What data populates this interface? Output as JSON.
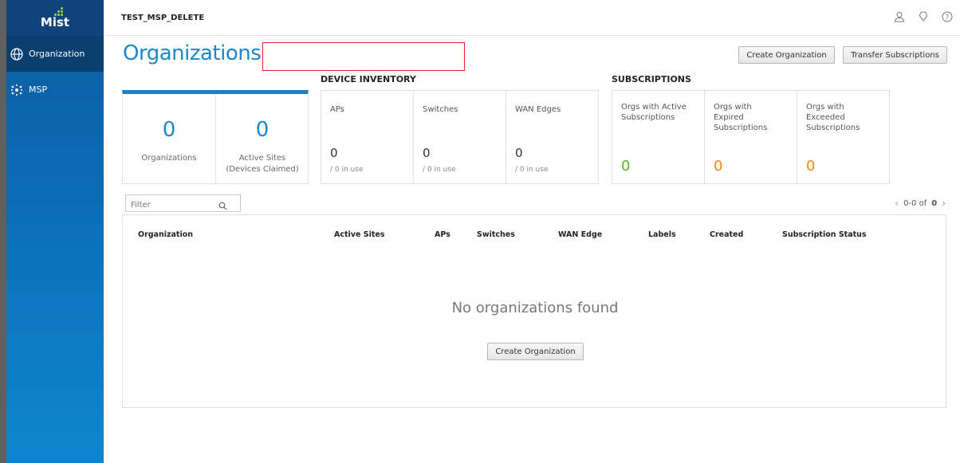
{
  "sidebar": {
    "logo_text": "Mist",
    "items": [
      {
        "label": "Organization",
        "icon": "globe-icon"
      },
      {
        "label": "MSP",
        "icon": "msp-dots-icon"
      }
    ]
  },
  "topbar": {
    "msp_name": "TEST_MSP_DELETE",
    "icons": [
      "user-icon",
      "lightbulb-icon",
      "help-icon"
    ]
  },
  "main": {
    "title": "Organizations",
    "buttons": {
      "create_organization": "Create Organization",
      "transfer_subscriptions": "Transfer Subscriptions"
    },
    "stats": {
      "organizations": {
        "value": "0",
        "label": "Organizations"
      },
      "active_sites": {
        "value": "0",
        "label_line1": "Active Sites",
        "label_line2": "(Devices Claimed)"
      }
    },
    "device_inventory": {
      "heading": "DEVICE INVENTORY",
      "items": [
        {
          "label": "APs",
          "value": "0",
          "sub": "/ 0 in use"
        },
        {
          "label": "Switches",
          "value": "0",
          "sub": "/ 0 in use"
        },
        {
          "label": "WAN Edges",
          "value": "0",
          "sub": "/ 0 in use"
        }
      ]
    },
    "subscriptions": {
      "heading": "SUBSCRIPTIONS",
      "items": [
        {
          "line1": "Orgs with Active",
          "line2": "Subscriptions",
          "line3": "",
          "value": "0"
        },
        {
          "line1": "Orgs with",
          "line2": "Expired",
          "line3": "Subscriptions",
          "value": "0"
        },
        {
          "line1": "Orgs with",
          "line2": "Exceeded",
          "line3": "Subscriptions",
          "value": "0"
        }
      ]
    },
    "filter": {
      "placeholder": "Filter"
    },
    "pagination": {
      "range": "0-0 of",
      "total": "0"
    },
    "table": {
      "columns": [
        "Organization",
        "Active Sites",
        "APs",
        "Switches",
        "WAN Edge",
        "Labels",
        "Created",
        "Subscription Status"
      ],
      "empty_message": "No organizations found",
      "empty_button": "Create Organization"
    }
  },
  "colors": {
    "accent": "#1e88c9",
    "active_green": "#5cb82a",
    "warning_orange": "#f08a1c",
    "sidebar": "#0c72bd"
  }
}
